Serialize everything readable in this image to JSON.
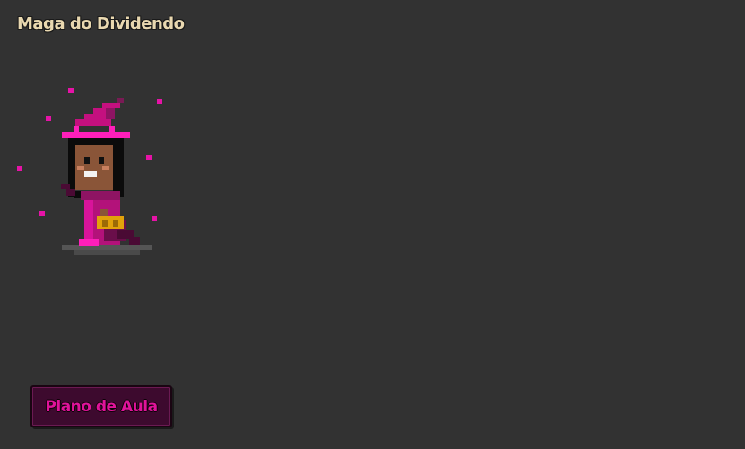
{
  "character": {
    "title": "Maga do Dividendo",
    "sprite_icon": "witch-sprite-icon"
  },
  "actions": {
    "lesson_plan_label": "Plano de Aula"
  },
  "colors": {
    "background": "#323232",
    "title_text": "#e9d8b0",
    "accent_magenta": "#e0139a",
    "button_bg": "#3d0a2e"
  }
}
